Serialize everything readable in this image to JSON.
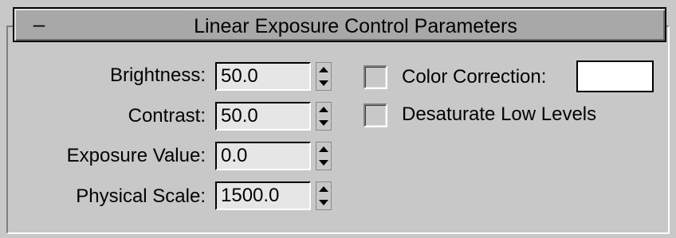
{
  "rollout": {
    "title": "Linear Exposure Control Parameters",
    "toggle": "–"
  },
  "params": [
    {
      "label": "Brightness:",
      "value": "50.0"
    },
    {
      "label": "Contrast:",
      "value": "50.0"
    },
    {
      "label": "Exposure Value:",
      "value": "0.0"
    },
    {
      "label": "Physical Scale:",
      "value": "1500.0"
    }
  ],
  "options": {
    "color_correction": {
      "label": "Color Correction:",
      "checked": false,
      "swatch_color": "#ffffff"
    },
    "desaturate_low_levels": {
      "label": "Desaturate Low Levels",
      "checked": false
    }
  },
  "icons": {
    "spin_up": "spinner-up-arrow-icon",
    "spin_down": "spinner-down-arrow-icon"
  }
}
